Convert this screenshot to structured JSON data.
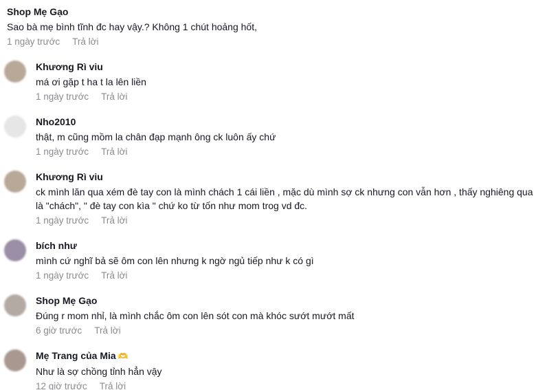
{
  "comments": [
    {
      "username": "Shop Mẹ Gạo",
      "text": "Sao bà mẹ bình tĩnh đc hay vậy.? Không 1 chút hoảng hốt,",
      "time": "1 ngày trước",
      "reply_label": "Trả lời",
      "avatar_color": ""
    },
    {
      "username": "Khương Rì viu",
      "text": "má ơi gặp t ha t la lên liền",
      "time": "1 ngày trước",
      "reply_label": "Trả lời",
      "avatar_color": "#b9a898"
    },
    {
      "username": "Nho2010",
      "text": "thật, m cũng mồm la chân đạp mạnh ông ck luôn ấy chứ",
      "time": "1 ngày trước",
      "reply_label": "Trả lời",
      "avatar_color": "#e6e6e6"
    },
    {
      "username": "Khương Rì viu",
      "text": "ck mình lăn qua xém đè tay con là mình chách 1 cái liền , mặc dù mình sợ ck nhưng con vẫn hơn , thấy nghiêng qua là \"chách\", \" đè tay con kìa \" chứ ko từ tốn như mom trog vd đc.",
      "time": "1 ngày trước",
      "reply_label": "Trả lời",
      "avatar_color": "#b9a898"
    },
    {
      "username": "bích như",
      "text": "mình cứ nghĩ bả sẽ ôm con lên nhưng k ngờ ngủ tiếp như k có gì",
      "time": "1 ngày trước",
      "reply_label": "Trả lời",
      "avatar_color": "#9a8fa6"
    },
    {
      "username": "Shop Mẹ Gạo",
      "text": "Đúng r mom nhỉ, là mình chắc ôm con lên sót con mà khóc sướt mướt mất",
      "time": "6 giờ trước",
      "reply_label": "Trả lời",
      "avatar_color": "#b3aaa4"
    },
    {
      "username": "Mẹ Trang của Mia",
      "badge": "🫶",
      "text": "Như là sợ chồng tỉnh hẳn vậy",
      "time": "12 giờ trước",
      "reply_label": "Trả lời",
      "avatar_color": "#a89890"
    }
  ]
}
